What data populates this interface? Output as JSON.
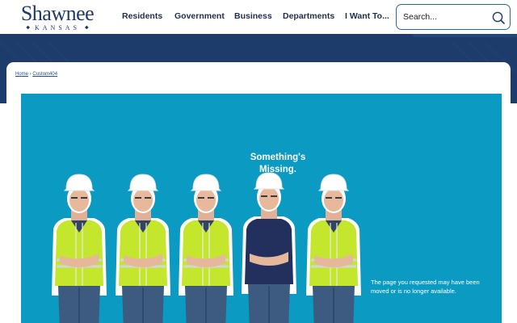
{
  "header": {
    "logo": {
      "name": "Shawnee",
      "state": "KANSAS"
    },
    "nav": [
      {
        "label": "Residents"
      },
      {
        "label": "Government"
      },
      {
        "label": "Business"
      },
      {
        "label": "Departments"
      },
      {
        "label": "I Want To..."
      }
    ],
    "search": {
      "placeholder": "Search...",
      "icon": "search-icon"
    }
  },
  "breadcrumb": {
    "items": [
      {
        "label": "Home"
      },
      {
        "label": "Custom404"
      }
    ],
    "separator": "›"
  },
  "banner": {
    "headline": "Something's Missing.",
    "message": "The page you requested may have been moved or is no longer available.",
    "colors": {
      "background": "#0b9ac1",
      "vest": "#c4e62c",
      "polo": "#23305e"
    }
  },
  "colors": {
    "brand": "#1e3c6b",
    "link": "#1f4fa0"
  }
}
